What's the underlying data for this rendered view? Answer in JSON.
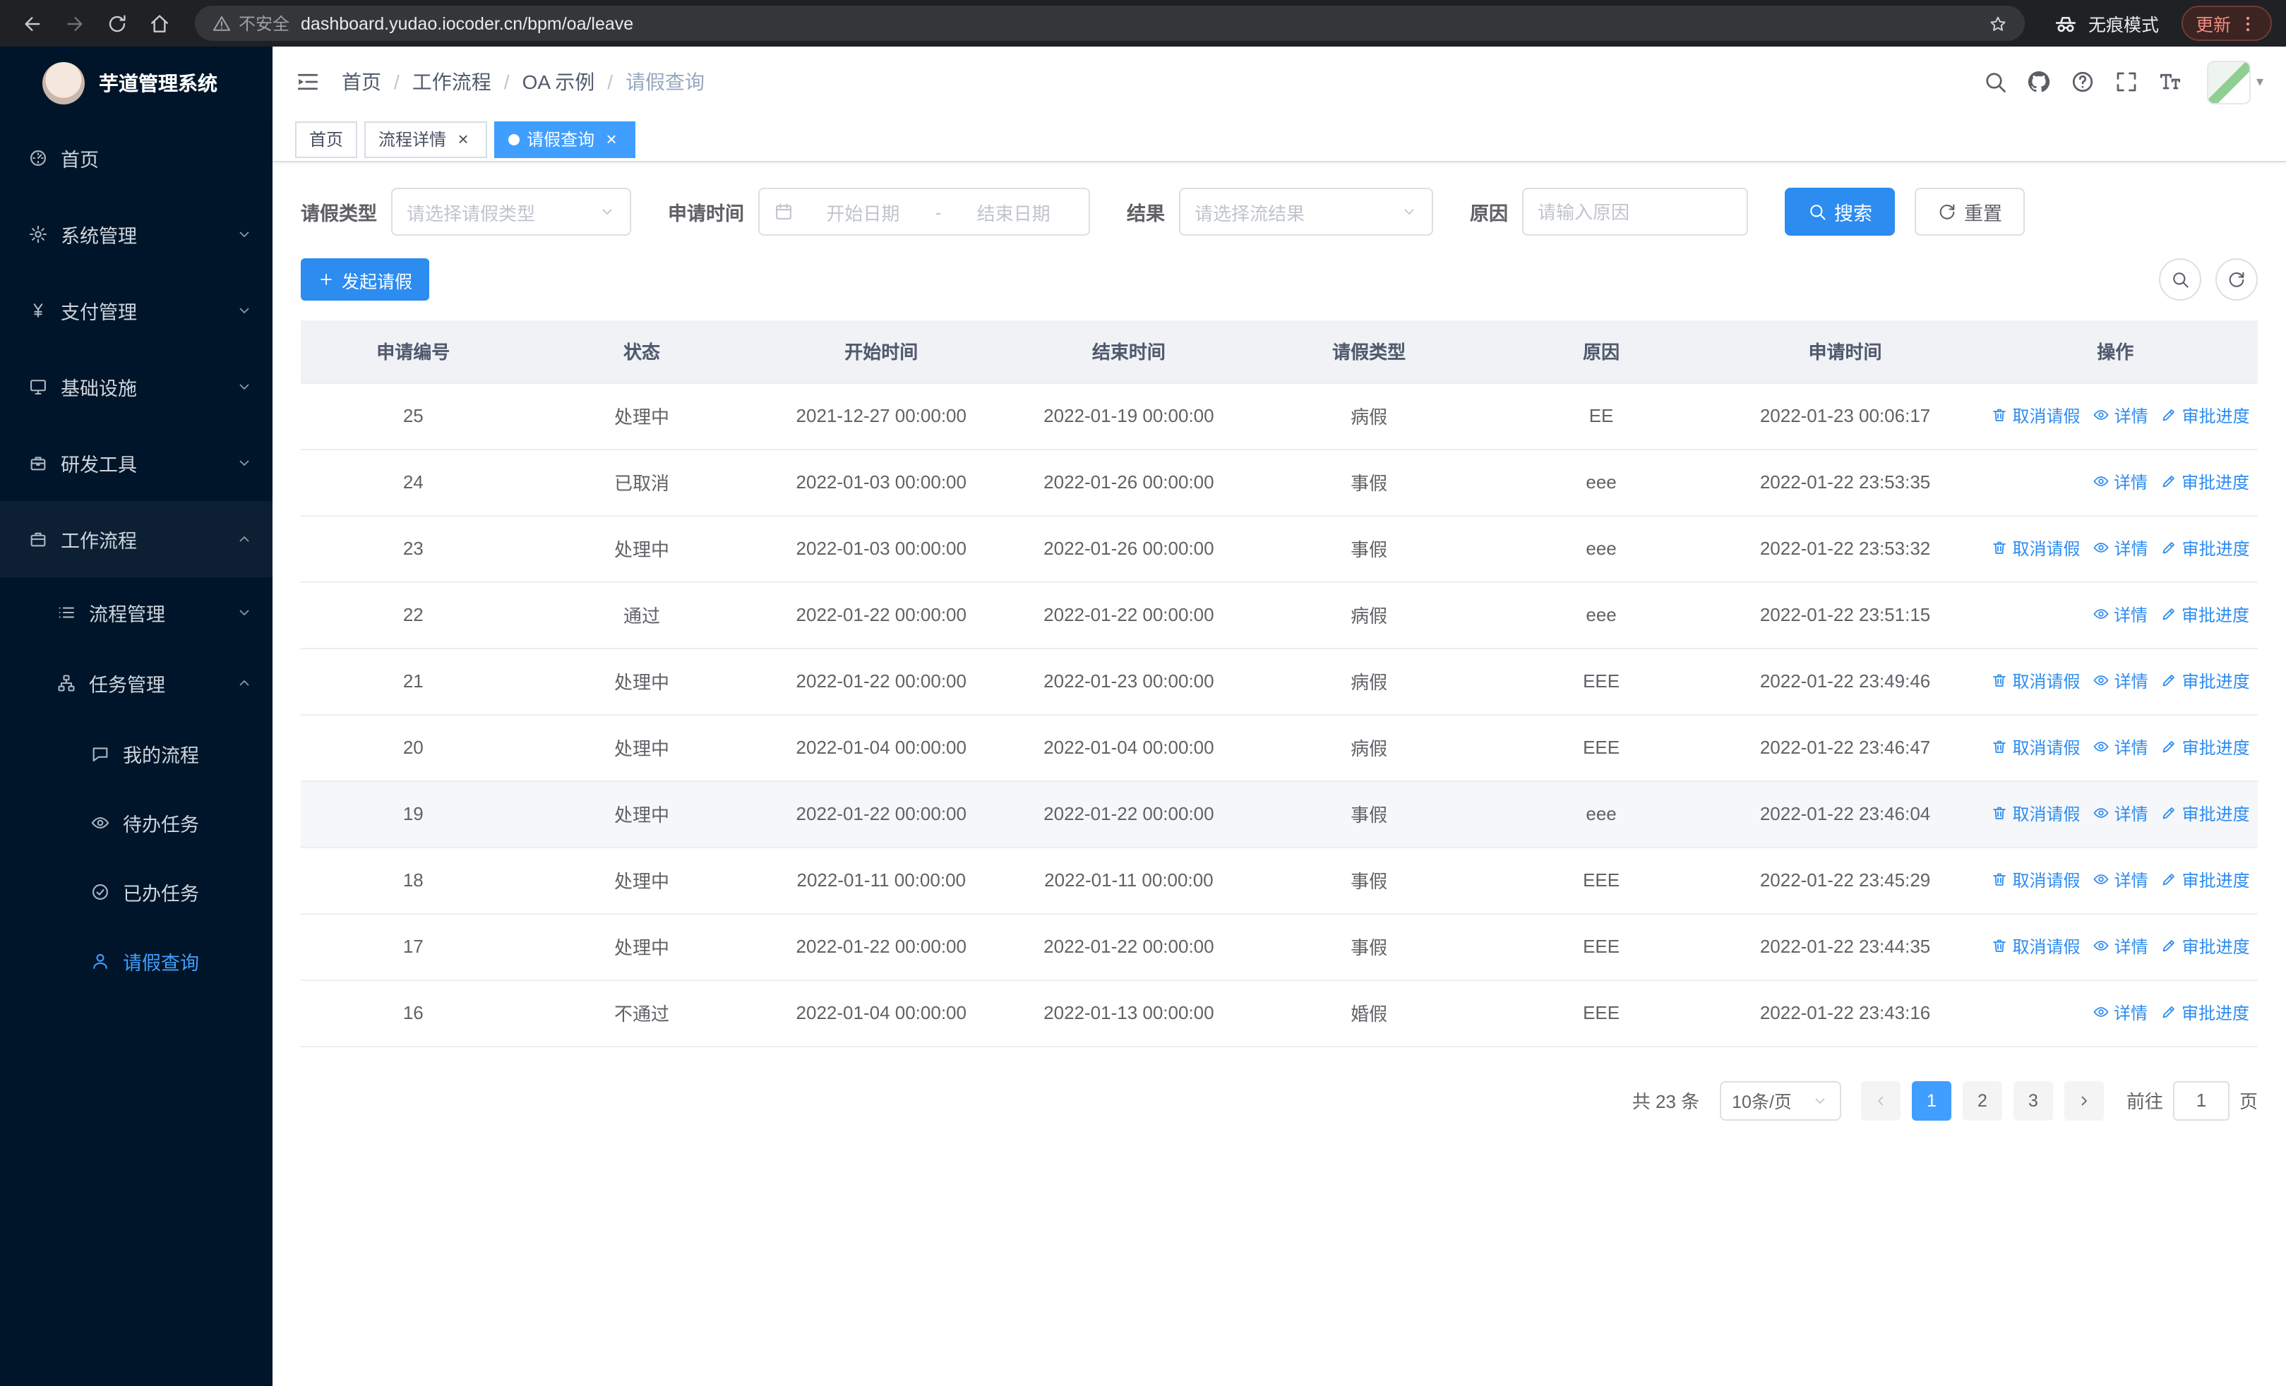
{
  "theme": {
    "accent": "#2d8cf0",
    "active_blue": "#409eff",
    "sidebar_bg": "#001529",
    "chrome_bg": "#202124",
    "update_red": "#f28b82"
  },
  "browser": {
    "security_warning": "不安全",
    "url": "dashboard.yudao.iocoder.cn/bpm/oa/leave",
    "incognito_label": "无痕模式",
    "update_label": "更新"
  },
  "sidebar": {
    "logo_title": "芋道管理系统",
    "menu": [
      {
        "key": "home",
        "label": "首页",
        "icon": "home"
      },
      {
        "key": "system",
        "label": "系统管理",
        "icon": "gear",
        "arrow": "down"
      },
      {
        "key": "payment",
        "label": "支付管理",
        "icon": "yen",
        "arrow": "down"
      },
      {
        "key": "infra",
        "label": "基础设施",
        "icon": "monitor",
        "arrow": "down"
      },
      {
        "key": "devtools",
        "label": "研发工具",
        "icon": "box",
        "arrow": "down"
      },
      {
        "key": "workflow",
        "label": "工作流程",
        "icon": "case",
        "arrow": "up",
        "open": true,
        "children": [
          {
            "key": "process-mgmt",
            "label": "流程管理",
            "icon": "list",
            "arrow": "down"
          },
          {
            "key": "task-mgmt",
            "label": "任务管理",
            "icon": "org",
            "arrow": "up",
            "open": true,
            "children": [
              {
                "key": "my-process",
                "label": "我的流程",
                "icon": "chat"
              },
              {
                "key": "todo-task",
                "label": "待办任务",
                "icon": "eye"
              },
              {
                "key": "done-task",
                "label": "已办任务",
                "icon": "check"
              },
              {
                "key": "leave-query",
                "label": "请假查询",
                "icon": "user",
                "active": true
              }
            ]
          }
        ]
      }
    ]
  },
  "header": {
    "breadcrumb": [
      "首页",
      "工作流程",
      "OA 示例",
      "请假查询"
    ]
  },
  "tabs": [
    {
      "key": "home",
      "label": "首页",
      "closable": false,
      "active": false
    },
    {
      "key": "process-detail",
      "label": "流程详情",
      "closable": true,
      "active": false
    },
    {
      "key": "leave-query",
      "label": "请假查询",
      "closable": true,
      "active": true
    }
  ],
  "filters": {
    "leave_type_label": "请假类型",
    "leave_type_placeholder": "请选择请假类型",
    "apply_time_label": "申请时间",
    "start_date_placeholder": "开始日期",
    "range_separator": "-",
    "end_date_placeholder": "结束日期",
    "result_label": "结果",
    "result_placeholder": "请选择流结果",
    "reason_label": "原因",
    "reason_placeholder": "请输入原因",
    "search_label": "搜索",
    "reset_label": "重置"
  },
  "toolbar": {
    "create_label": "发起请假"
  },
  "table": {
    "columns": [
      "申请编号",
      "状态",
      "开始时间",
      "结束时间",
      "请假类型",
      "原因",
      "申请时间",
      "操作"
    ],
    "actions": {
      "cancel": "取消请假",
      "detail": "详情",
      "progress": "审批进度"
    },
    "rows": [
      {
        "id": "25",
        "status": "处理中",
        "start": "2021-12-27 00:00:00",
        "end": "2022-01-19 00:00:00",
        "type": "病假",
        "reason": "EE",
        "applied": "2022-01-23 00:06:17",
        "cancellable": true,
        "hover": false
      },
      {
        "id": "24",
        "status": "已取消",
        "start": "2022-01-03 00:00:00",
        "end": "2022-01-26 00:00:00",
        "type": "事假",
        "reason": "eee",
        "applied": "2022-01-22 23:53:35",
        "cancellable": false,
        "hover": false
      },
      {
        "id": "23",
        "status": "处理中",
        "start": "2022-01-03 00:00:00",
        "end": "2022-01-26 00:00:00",
        "type": "事假",
        "reason": "eee",
        "applied": "2022-01-22 23:53:32",
        "cancellable": true,
        "hover": false
      },
      {
        "id": "22",
        "status": "通过",
        "start": "2022-01-22 00:00:00",
        "end": "2022-01-22 00:00:00",
        "type": "病假",
        "reason": "eee",
        "applied": "2022-01-22 23:51:15",
        "cancellable": false,
        "hover": false
      },
      {
        "id": "21",
        "status": "处理中",
        "start": "2022-01-22 00:00:00",
        "end": "2022-01-23 00:00:00",
        "type": "病假",
        "reason": "EEE",
        "applied": "2022-01-22 23:49:46",
        "cancellable": true,
        "hover": false
      },
      {
        "id": "20",
        "status": "处理中",
        "start": "2022-01-04 00:00:00",
        "end": "2022-01-04 00:00:00",
        "type": "病假",
        "reason": "EEE",
        "applied": "2022-01-22 23:46:47",
        "cancellable": true,
        "hover": false
      },
      {
        "id": "19",
        "status": "处理中",
        "start": "2022-01-22 00:00:00",
        "end": "2022-01-22 00:00:00",
        "type": "事假",
        "reason": "eee",
        "applied": "2022-01-22 23:46:04",
        "cancellable": true,
        "hover": true
      },
      {
        "id": "18",
        "status": "处理中",
        "start": "2022-01-11 00:00:00",
        "end": "2022-01-11 00:00:00",
        "type": "事假",
        "reason": "EEE",
        "applied": "2022-01-22 23:45:29",
        "cancellable": true,
        "hover": false
      },
      {
        "id": "17",
        "status": "处理中",
        "start": "2022-01-22 00:00:00",
        "end": "2022-01-22 00:00:00",
        "type": "事假",
        "reason": "EEE",
        "applied": "2022-01-22 23:44:35",
        "cancellable": true,
        "hover": false
      },
      {
        "id": "16",
        "status": "不通过",
        "start": "2022-01-04 00:00:00",
        "end": "2022-01-13 00:00:00",
        "type": "婚假",
        "reason": "EEE",
        "applied": "2022-01-22 23:43:16",
        "cancellable": false,
        "hover": false
      }
    ]
  },
  "pagination": {
    "total_text": "共 23 条",
    "page_size": "10条/页",
    "pages": [
      "1",
      "2",
      "3"
    ],
    "active_page": "1",
    "goto_label": "前往",
    "goto_value": "1",
    "goto_suffix": "页"
  }
}
